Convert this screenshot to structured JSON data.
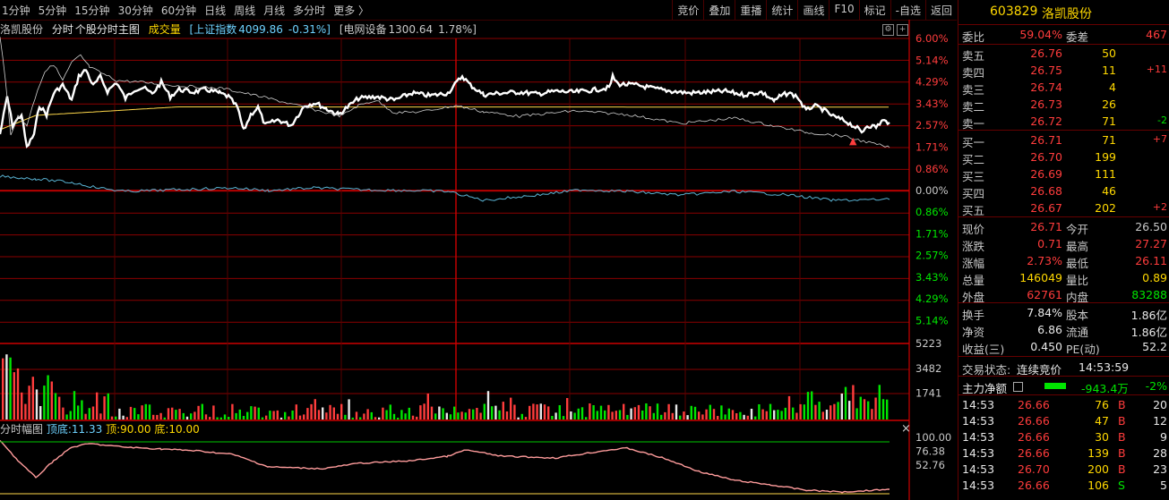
{
  "toolbar": {
    "periods": [
      "1分钟",
      "5分钟",
      "15分钟",
      "30分钟",
      "60分钟",
      "日线",
      "周线",
      "月线",
      "多分时",
      "更多 〉"
    ],
    "tools": [
      "竞价",
      "叠加",
      "重播",
      "统计",
      "画线",
      "F10",
      "标记",
      "-自选",
      "返回"
    ]
  },
  "infoline": {
    "stock_name": "洛凯股份",
    "mode": "分时",
    "main_chart": "个股分时主图",
    "volume_label": "成交量",
    "index_name": "[上证指数",
    "index_value": "4099.86",
    "index_change": "-0.31%]",
    "sector": "[电网设备",
    "sector_value": "1300.64",
    "sector_change": "1.78%]"
  },
  "axis": {
    "price_up": [
      "6.00%",
      "5.14%",
      "4.29%",
      "3.43%",
      "2.57%",
      "1.71%",
      "0.86%"
    ],
    "zero": "0.00%",
    "price_down": [
      "0.86%",
      "1.71%",
      "2.57%",
      "3.43%",
      "4.29%",
      "5.14%"
    ],
    "volume": [
      "5223",
      "3482",
      "1741"
    ],
    "osc": [
      "100.00",
      "76.38",
      "52.76"
    ]
  },
  "osc_header": {
    "name": "分时幅图",
    "top_label": "顶底:",
    "top_value": "11.33",
    "ding_label": "顶:",
    "ding_value": "90.00",
    "di_label": "底:",
    "di_value": "10.00"
  },
  "colors": {
    "up": "#ff3c3c",
    "down": "#00e600",
    "price": "#ffffff",
    "avg": "#ffd84a",
    "flow": "#5ab4d4",
    "osc": "#ff9c9c",
    "grid": "#8a0000"
  },
  "panel": {
    "code": "603829",
    "name": "洛凯股份",
    "weibi_label": "委比",
    "weibi": "59.04%",
    "weicha_label": "委差",
    "weicha": "467",
    "asks": [
      {
        "label": "卖五",
        "price": "26.76",
        "vol": "50",
        "chg": ""
      },
      {
        "label": "卖四",
        "price": "26.75",
        "vol": "11",
        "chg": "+11"
      },
      {
        "label": "卖三",
        "price": "26.74",
        "vol": "4",
        "chg": ""
      },
      {
        "label": "卖二",
        "price": "26.73",
        "vol": "26",
        "chg": ""
      },
      {
        "label": "卖一",
        "price": "26.72",
        "vol": "71",
        "chg": "-2"
      }
    ],
    "bids": [
      {
        "label": "买一",
        "price": "26.71",
        "vol": "71",
        "chg": "+7"
      },
      {
        "label": "买二",
        "price": "26.70",
        "vol": "199",
        "chg": ""
      },
      {
        "label": "买三",
        "price": "26.69",
        "vol": "111",
        "chg": ""
      },
      {
        "label": "买四",
        "price": "26.68",
        "vol": "46",
        "chg": ""
      },
      {
        "label": "买五",
        "price": "26.67",
        "vol": "202",
        "chg": "+2"
      }
    ],
    "quote": [
      {
        "l1": "现价",
        "v1": "26.71",
        "c1": "red",
        "l2": "今开",
        "v2": "26.50",
        "c2": "gray"
      },
      {
        "l1": "涨跌",
        "v1": "0.71",
        "c1": "red",
        "l2": "最高",
        "v2": "27.27",
        "c2": "red"
      },
      {
        "l1": "涨幅",
        "v1": "2.73%",
        "c1": "red",
        "l2": "最低",
        "v2": "26.11",
        "c2": "red"
      },
      {
        "l1": "总量",
        "v1": "146049",
        "c1": "yel",
        "l2": "量比",
        "v2": "0.89",
        "c2": "yel"
      },
      {
        "l1": "外盘",
        "v1": "62761",
        "c1": "red",
        "l2": "内盘",
        "v2": "83288",
        "c2": "green"
      }
    ],
    "fund": [
      {
        "l1": "换手",
        "v1": "7.84%",
        "l2": "股本",
        "v2": "1.86亿"
      },
      {
        "l1": "净资",
        "v1": "6.86",
        "l2": "流通",
        "v2": "1.86亿"
      },
      {
        "l1": "收益(三)",
        "v1": "0.450",
        "l2": "PE(动)",
        "v2": "52.2"
      }
    ],
    "status_label": "交易状态:",
    "status_value": "连续竞价",
    "status_time": "14:53:59",
    "flow_label": "主力净额",
    "flow_value": "-943.4万",
    "flow_pct": "-2%",
    "ticks": [
      {
        "time": "14:53",
        "price": "26.66",
        "vol": "76",
        "bs": "B",
        "n": "20"
      },
      {
        "time": "14:53",
        "price": "26.66",
        "vol": "47",
        "bs": "B",
        "n": "12"
      },
      {
        "time": "14:53",
        "price": "26.66",
        "vol": "30",
        "bs": "B",
        "n": "9"
      },
      {
        "time": "14:53",
        "price": "26.66",
        "vol": "139",
        "bs": "B",
        "n": "28"
      },
      {
        "time": "14:53",
        "price": "26.70",
        "vol": "200",
        "bs": "B",
        "n": "23"
      },
      {
        "time": "14:53",
        "price": "26.66",
        "vol": "106",
        "bs": "S",
        "n": "5"
      }
    ]
  }
}
